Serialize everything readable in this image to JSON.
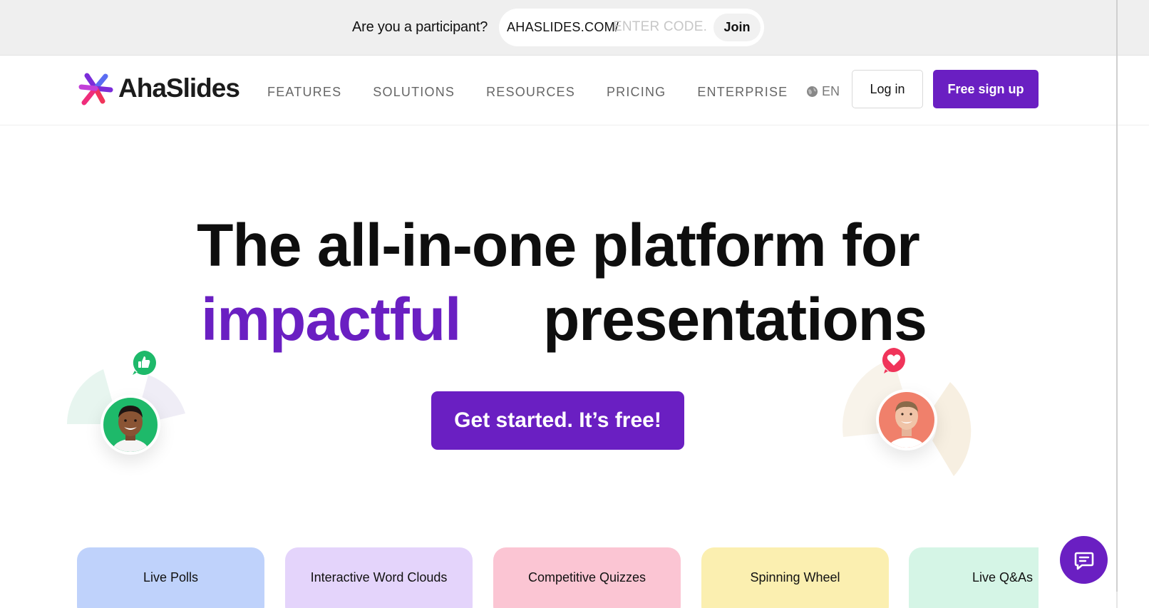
{
  "participant_bar": {
    "question": "Are you a participant?",
    "url_prefix": "AHASLIDES.COM/",
    "code_placeholder": "ENTER CODE.",
    "join_label": "Join"
  },
  "header": {
    "logo_text": "AhaSlides",
    "nav": [
      "FEATURES",
      "SOLUTIONS",
      "RESOURCES",
      "PRICING",
      "ENTERPRISE"
    ],
    "language": "EN",
    "login_label": "Log in",
    "signup_label": "Free sign up"
  },
  "hero": {
    "line1": "The all-in-one platform for",
    "highlight": "impactful",
    "line2_rest": "presentations",
    "cta_label": "Get started. It’s free!"
  },
  "features": [
    {
      "label": "Live Polls",
      "color": "#bfd2fb"
    },
    {
      "label": "Interactive Word Clouds",
      "color": "#e4d4fb"
    },
    {
      "label": "Competitive Quizzes",
      "color": "#fbc5d3"
    },
    {
      "label": "Spinning Wheel",
      "color": "#fbefb0"
    },
    {
      "label": "Live Q&As",
      "color": "#d5f5e6"
    }
  ],
  "colors": {
    "brand_purple": "#6a1fc2",
    "like_green": "#1eb96a",
    "heart_pink": "#f0345a"
  },
  "icons": {
    "logo": "ahaslides-logo-icon",
    "language": "globe-icon",
    "chat": "chat-bubble-icon",
    "like": "thumbs-up-icon",
    "heart": "heart-icon"
  }
}
